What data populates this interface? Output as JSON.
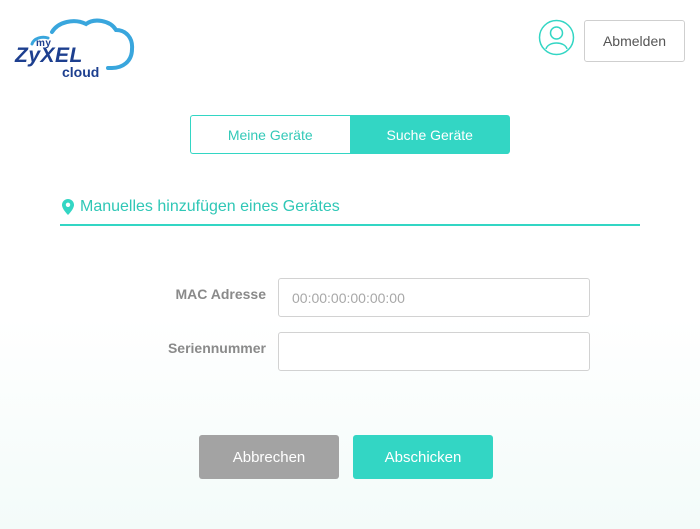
{
  "header": {
    "logo": {
      "my": "my",
      "brand": "ZyXEL",
      "cloud": "cloud"
    },
    "user_icon": "user-circle-icon",
    "logout_label": "Abmelden"
  },
  "tabs": [
    {
      "label": "Meine Geräte",
      "active": false
    },
    {
      "label": "Suche Geräte",
      "active": true
    }
  ],
  "section": {
    "icon": "map-pin-icon",
    "title": "Manuelles hinzufügen eines Gerätes"
  },
  "form": {
    "mac": {
      "label": "MAC Adresse",
      "placeholder": "00:00:00:00:00:00",
      "value": ""
    },
    "serial": {
      "label": "Seriennummer",
      "placeholder": "",
      "value": ""
    }
  },
  "actions": {
    "cancel_label": "Abbrechen",
    "submit_label": "Abschicken"
  },
  "colors": {
    "accent": "#33d6c4",
    "brand": "#1d3f8f",
    "cancel": "#a3a3a3"
  }
}
